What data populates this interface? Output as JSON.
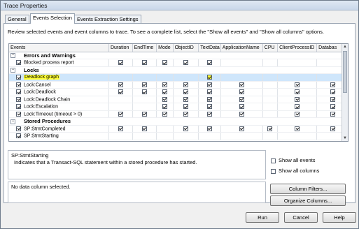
{
  "window": {
    "title": "Trace Properties"
  },
  "tabs": [
    {
      "label": "General",
      "active": false
    },
    {
      "label": "Events Selection",
      "active": true
    },
    {
      "label": "Events Extraction Settings",
      "active": false
    }
  ],
  "description": "Review selected events and event columns to trace. To see a complete list, select the \"Show all events\" and \"Show all columns\" options.",
  "grid": {
    "columns": [
      "Events",
      "Duration",
      "EndTime",
      "Mode",
      "ObjectID",
      "TextData",
      "ApplicationName",
      "CPU",
      "ClientProcessID",
      "Databas"
    ],
    "rows": [
      {
        "type": "category",
        "label": "Errors and Warnings",
        "expanded": true
      },
      {
        "type": "event",
        "label": "Blocked process report",
        "selected": false,
        "checks": [
          true,
          true,
          true,
          true,
          true,
          false,
          false,
          false,
          false
        ]
      },
      {
        "type": "category",
        "label": "Locks",
        "expanded": true
      },
      {
        "type": "event",
        "label": "Deadlock graph",
        "selected": true,
        "highlight": true,
        "checks": [
          false,
          false,
          false,
          false,
          true,
          false,
          false,
          false,
          false
        ]
      },
      {
        "type": "event",
        "label": "Lock:Cancel",
        "selected": false,
        "checks": [
          true,
          true,
          true,
          true,
          true,
          true,
          false,
          true,
          true
        ]
      },
      {
        "type": "event",
        "label": "Lock:Deadlock",
        "selected": false,
        "checks": [
          true,
          true,
          true,
          true,
          true,
          true,
          false,
          true,
          true
        ]
      },
      {
        "type": "event",
        "label": "Lock:Deadlock Chain",
        "selected": false,
        "checks": [
          false,
          false,
          true,
          true,
          true,
          true,
          false,
          true,
          true
        ]
      },
      {
        "type": "event",
        "label": "Lock:Escalation",
        "selected": false,
        "checks": [
          false,
          false,
          true,
          true,
          true,
          true,
          false,
          true,
          true
        ]
      },
      {
        "type": "event",
        "label": "Lock:Timeout (timeout > 0)",
        "selected": false,
        "checks": [
          true,
          true,
          true,
          true,
          true,
          true,
          false,
          true,
          true
        ]
      },
      {
        "type": "category",
        "label": "Stored Procedures",
        "expanded": true
      },
      {
        "type": "event",
        "label": "SP:StmtCompleted",
        "selected": false,
        "checks": [
          true,
          true,
          false,
          true,
          true,
          true,
          true,
          true,
          true
        ]
      },
      {
        "type": "event",
        "label": "SP:StmtStarting",
        "selected": false,
        "checks": [
          false,
          false,
          false,
          false,
          false,
          false,
          false,
          false,
          false
        ]
      }
    ]
  },
  "event_description": {
    "title": "SP:StmtStarting",
    "text": "Indicates that a Transact-SQL statement within a stored procedure has started."
  },
  "options": {
    "show_all_events": {
      "label": "Show all events",
      "checked": false
    },
    "show_all_columns": {
      "label": "Show all columns",
      "checked": false
    }
  },
  "column_info": "No data column selected.",
  "buttons": {
    "column_filters": "Column Filters...",
    "organize_columns": "Organize Columns...",
    "run": "Run",
    "cancel": "Cancel",
    "help": "Help"
  },
  "colors": {
    "selection": "#cfe6fb",
    "highlight": "#ffff33"
  }
}
